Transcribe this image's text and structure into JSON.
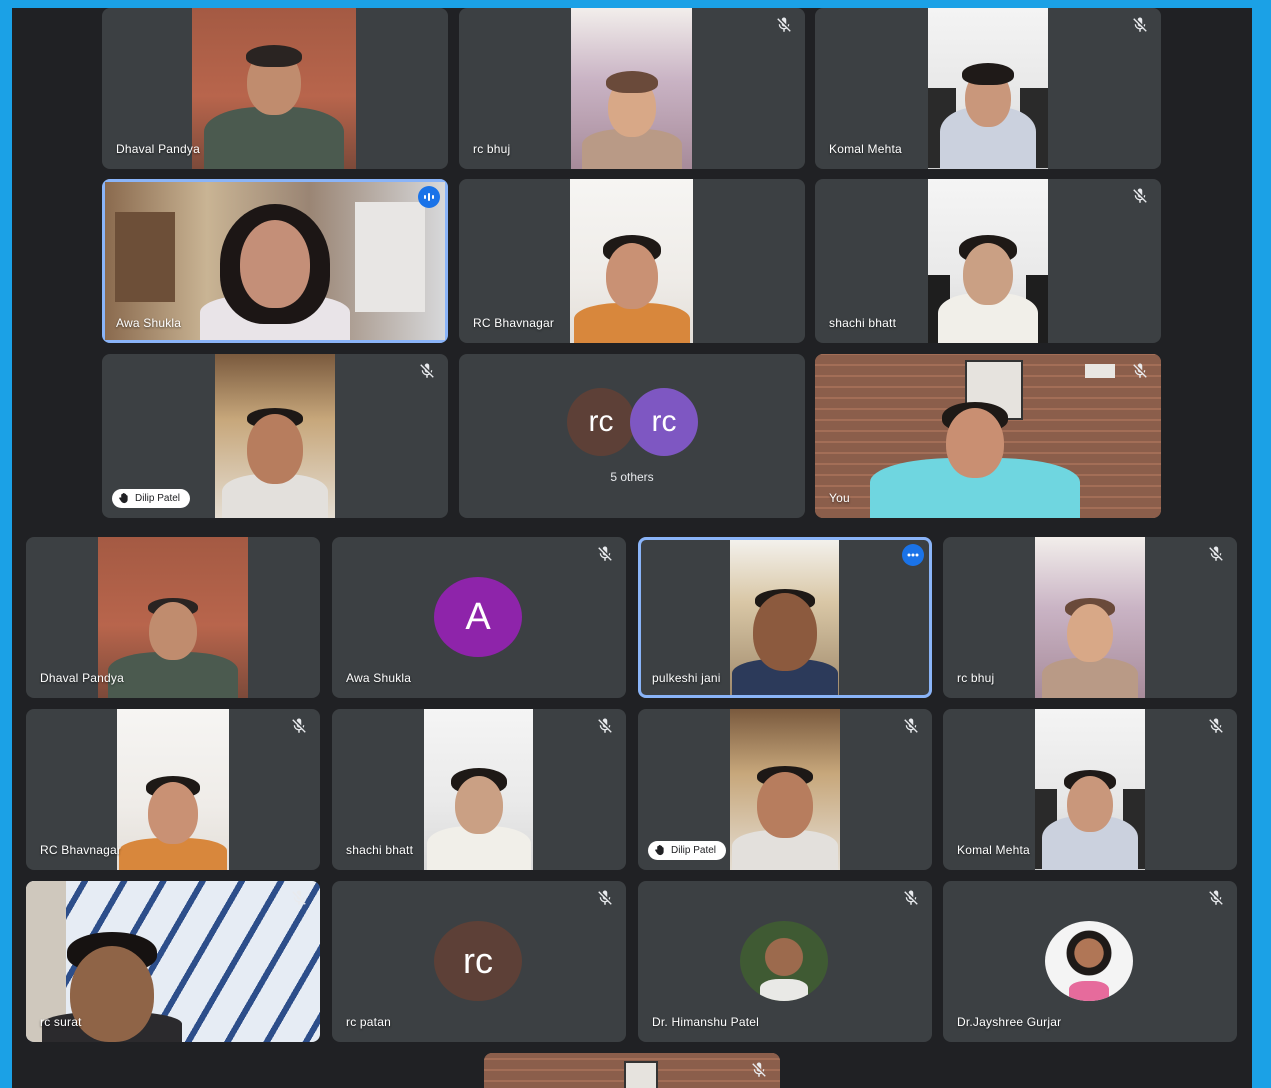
{
  "upper_grid": [
    {
      "name": "Dhaval Pandya"
    },
    {
      "name": "rc bhuj"
    },
    {
      "name": "Komal Mehta"
    },
    {
      "name": "Awa Shukla"
    },
    {
      "name": "RC Bhavnagar"
    },
    {
      "name": "shachi bhatt"
    },
    {
      "name": "Dilip Patel"
    },
    {
      "others": {
        "avatars": [
          "rc",
          "rc"
        ],
        "label": "5 others"
      }
    },
    {
      "name": "You"
    }
  ],
  "lower_grid": [
    {
      "name": "Dhaval Pandya"
    },
    {
      "name": "Awa Shukla",
      "avatar_letter": "A"
    },
    {
      "name": "pulkeshi jani"
    },
    {
      "name": "rc bhuj"
    },
    {
      "name": "RC Bhavnagar"
    },
    {
      "name": "shachi bhatt"
    },
    {
      "name": "Dilip Patel"
    },
    {
      "name": "Komal Mehta"
    },
    {
      "name": "rc surat"
    },
    {
      "name": "rc patan",
      "avatar_letter": "rc"
    },
    {
      "name": "Dr. Himanshu Patel"
    },
    {
      "name": "Dr.Jayshree Gurjar"
    }
  ],
  "colors": {
    "background": "#202124",
    "tile": "#3c4043",
    "border": "#1ba1e6",
    "active": "#8ab4f8",
    "badge": "#1a73e8",
    "avatar_purple": "#8e24aa",
    "avatar_brown": "#5d4037",
    "avatar_violet": "#7e57c2"
  },
  "icons": {
    "mute": "mic-off-icon",
    "speaking": "audio-wave-icon",
    "more": "more-options-icon",
    "hand": "raised-hand-icon"
  }
}
